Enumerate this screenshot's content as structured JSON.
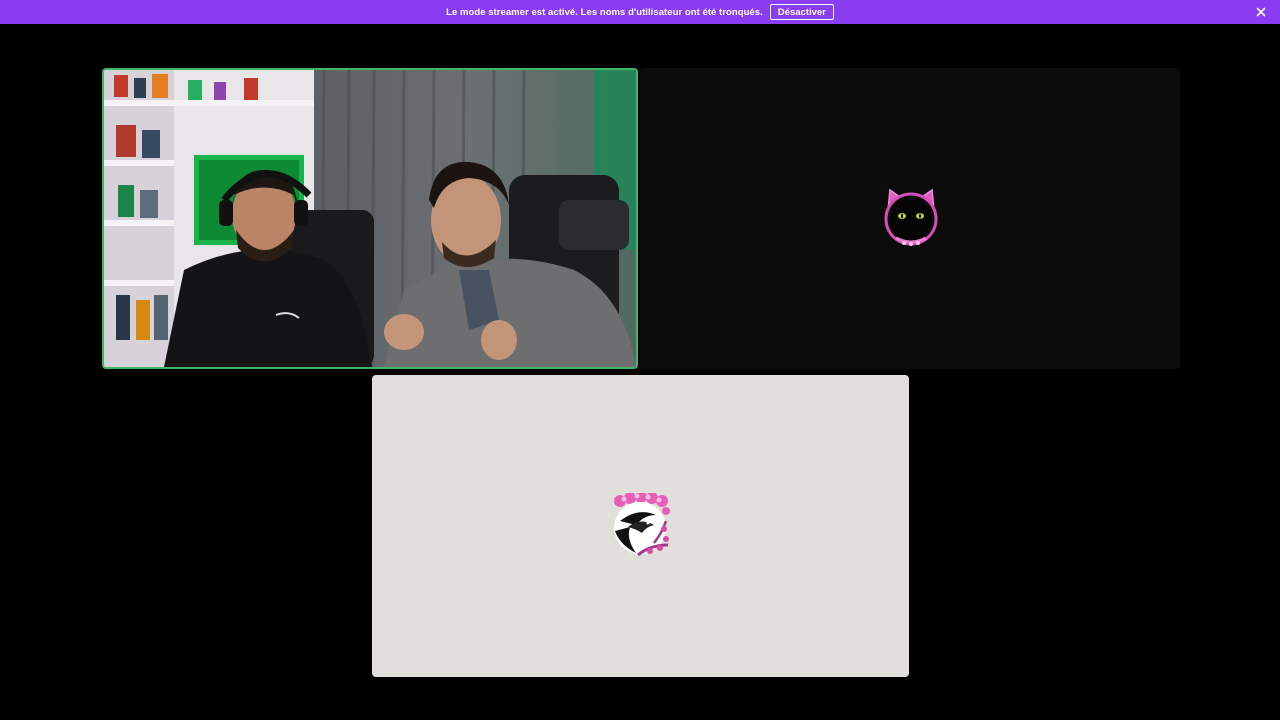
{
  "banner": {
    "message": "Le mode streamer est activé. Les noms d'utilisateur ont été tronqués.",
    "deactivate_label": "Désactiver",
    "background": "#8a3cf0",
    "close_icon": "close-icon"
  },
  "call": {
    "tiles": [
      {
        "kind": "video",
        "speaking": true,
        "border_color": "#3fb866"
      },
      {
        "kind": "avatar",
        "avatar": "black-cat-with-pink-bow"
      },
      {
        "kind": "avatar",
        "avatar": "bird-with-cherry-blossoms"
      }
    ]
  }
}
